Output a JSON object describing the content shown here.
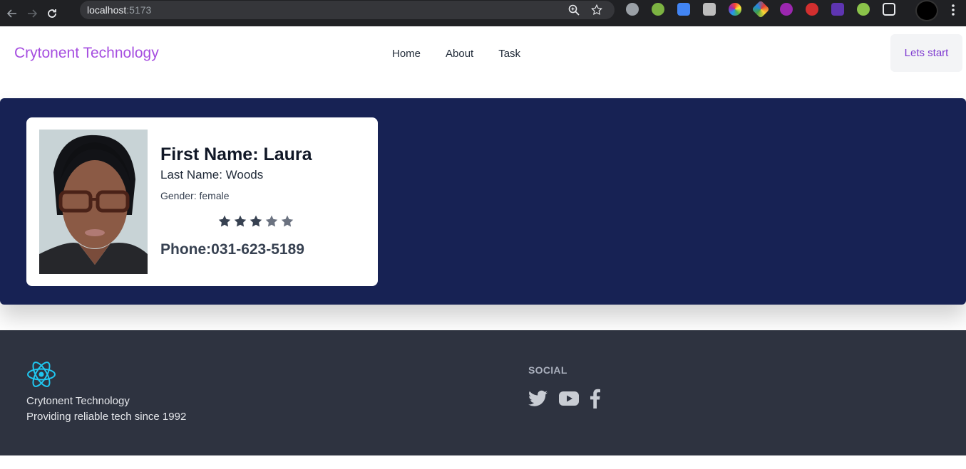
{
  "browser": {
    "url_host": "localhost",
    "url_port": ":5173"
  },
  "header": {
    "brand": "Crytonent Technology",
    "nav": [
      "Home",
      "About",
      "Task"
    ],
    "cta_label": "Lets start"
  },
  "profile": {
    "first_name": "First Name: Laura",
    "last_name": "Last Name: Woods",
    "gender": "Gender: female",
    "rating": 3,
    "rating_max": 5,
    "phone": "Phone:031-623-5189"
  },
  "footer": {
    "logo_icon": "react-atom-icon",
    "company": "Crytonent Technology",
    "tagline": "Providing reliable tech since 1992",
    "social_title": "SOCIAL",
    "social_icons": [
      "twitter-icon",
      "youtube-icon",
      "facebook-icon"
    ]
  },
  "colors": {
    "brand": "#a64ee0",
    "hero_bg": "#172254",
    "footer_bg": "#2e3340",
    "star_filled": "#374151",
    "star_empty": "#6b7280"
  }
}
